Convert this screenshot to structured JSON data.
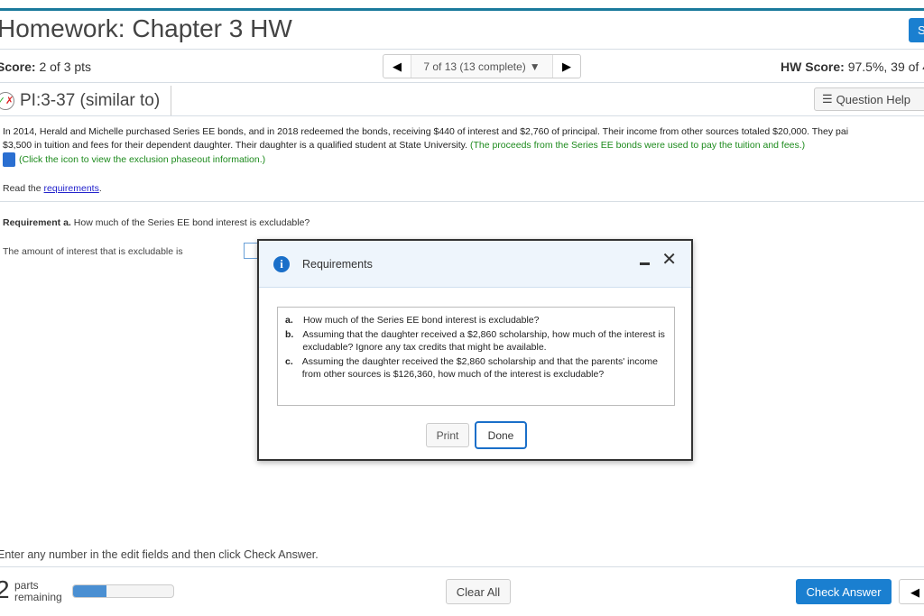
{
  "header": {
    "title": "Homework: Chapter 3 HW",
    "save_label": "S"
  },
  "score_bar": {
    "score_label": "Score:",
    "score_value": "2 of 3 pts",
    "nav_text": "7 of 13 (13 complete)",
    "hw_label": "HW Score:",
    "hw_value": "97.5%, 39 of 4"
  },
  "question": {
    "id": "PI:3-37 (similar to)",
    "help_label": "Question Help",
    "text1": "In 2014, Herald and Michelle purchased Series EE bonds, and in 2018 redeemed the bonds, receiving $440 of interest and $2,760 of principal. Their income from other sources totaled $20,000. They pai",
    "text2": "$3,500 in tuition and fees for their dependent daughter. Their daughter is a qualified student at State University.",
    "text2_green": "(The proceeds from the Series EE bonds were used to pay the tuition and fees.)",
    "icon_text": "(Click the icon to view the exclusion phaseout information.)",
    "read_prefix": "Read the",
    "read_link": "requirements",
    "read_suffix": ".",
    "req_label": "Requirement a.",
    "req_text": "How much of the Series EE bond interest is excludable?",
    "amount_label": "The amount of interest that is excludable is"
  },
  "modal": {
    "title": "Requirements",
    "items": [
      {
        "letter": "a.",
        "text": "How much of the Series EE bond interest is excludable?"
      },
      {
        "letter": "b.",
        "text": "Assuming that the daughter received a $2,860 scholarship, how much of the interest is excludable? Ignore any tax credits that might be available."
      },
      {
        "letter": "c.",
        "text": "Assuming the daughter received the $2,860 scholarship and that the parents' income from other sources is $126,360, how much of the interest is excludable?"
      }
    ],
    "print_label": "Print",
    "done_label": "Done"
  },
  "footer": {
    "instruction": "Enter any number in the edit fields and then click Check Answer.",
    "parts_count": "2",
    "parts_line1": "parts",
    "parts_line2": "remaining",
    "progress_fraction": 0.33,
    "clear_label": "Clear All",
    "check_label": "Check Answer"
  }
}
